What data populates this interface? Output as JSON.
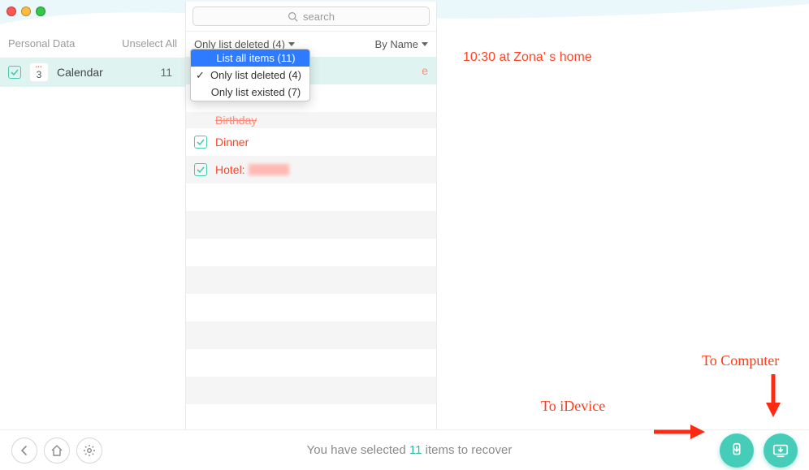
{
  "window": {
    "title": ""
  },
  "search": {
    "placeholder": "search"
  },
  "sidebar": {
    "header_label": "Personal Data",
    "unselect_label": "Unselect All",
    "items": [
      {
        "label": "Calendar",
        "count": "11",
        "icon_num": "3"
      }
    ]
  },
  "filter": {
    "current": "Only list deleted (4)",
    "sort": "By Name",
    "options": [
      "List all items (11)",
      "Only list deleted (4)",
      "Only list existed (7)"
    ]
  },
  "items": [
    {
      "label": "",
      "selected": true,
      "hidden_by_menu": true
    },
    {
      "label": "",
      "selected": true,
      "hidden_by_menu": true
    },
    {
      "label": "Birthday",
      "selected": true,
      "partially_hidden": true
    },
    {
      "label": "Dinner",
      "selected": true
    },
    {
      "label_prefix": "Hotel:",
      "redacted": true,
      "selected": true
    }
  ],
  "detail": {
    "text": "10:30 at Zona' s home"
  },
  "footer": {
    "status_pre": "You have selected ",
    "status_count": "11",
    "status_post": " items to recover"
  },
  "annotations": {
    "to_idevice": "To iDevice",
    "to_computer": "To Computer"
  }
}
